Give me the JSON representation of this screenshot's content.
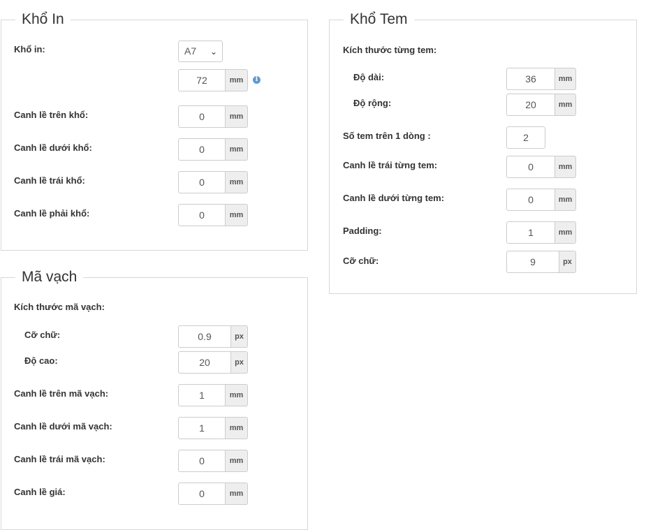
{
  "kho_in": {
    "title": "Khổ In",
    "kho_in_label": "Khổ in:",
    "paper_select": "A7",
    "paper_width": "72",
    "info_icon": "info-circle-icon",
    "fields": [
      {
        "label": "Canh lề trên khổ:",
        "value": "0",
        "unit": "mm"
      },
      {
        "label": "Canh lề dưới khổ:",
        "value": "0",
        "unit": "mm"
      },
      {
        "label": "Canh lề trái khổ:",
        "value": "0",
        "unit": "mm"
      },
      {
        "label": "Canh lề phải khổ:",
        "value": "0",
        "unit": "mm"
      }
    ],
    "unit": "mm"
  },
  "ma_vach": {
    "title": "Mã vạch",
    "size_label": "Kích thước mã vạch:",
    "sub_fields": [
      {
        "label": "Cỡ chữ:",
        "value": "0.9",
        "unit": "px"
      },
      {
        "label": "Độ cao:",
        "value": "20",
        "unit": "px"
      }
    ],
    "fields": [
      {
        "label": "Canh lề trên mã vạch:",
        "value": "1",
        "unit": "mm"
      },
      {
        "label": "Canh lề dưới mã vạch:",
        "value": "1",
        "unit": "mm"
      },
      {
        "label": "Canh lề trái mã vạch:",
        "value": "0",
        "unit": "mm"
      },
      {
        "label": "Canh lề giá:",
        "value": "0",
        "unit": "mm"
      }
    ]
  },
  "kho_tem": {
    "title": "Khổ Tem",
    "size_label": "Kích thước từng tem:",
    "sub_fields": [
      {
        "label": "Độ dài:",
        "value": "36",
        "unit": "mm"
      },
      {
        "label": "Độ rộng:",
        "value": "20",
        "unit": "mm"
      }
    ],
    "per_row_label": "Số tem trên 1 dòng :",
    "per_row_value": "2",
    "fields": [
      {
        "label": "Canh lề trái từng tem:",
        "value": "0",
        "unit": "mm"
      },
      {
        "label": "Canh lề dưới từng tem:",
        "value": "0",
        "unit": "mm"
      },
      {
        "label": "Padding:",
        "value": "1",
        "unit": "mm"
      },
      {
        "label": "Cỡ chữ:",
        "value": "9",
        "unit": "px"
      }
    ]
  }
}
